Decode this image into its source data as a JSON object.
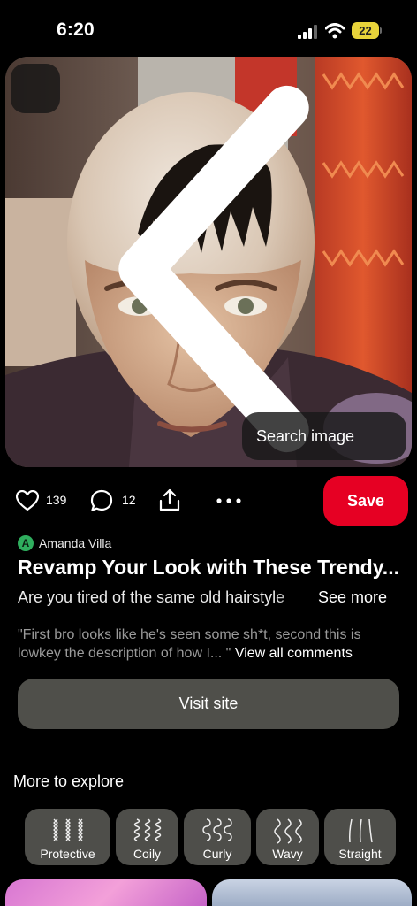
{
  "status_bar": {
    "time": "6:20",
    "battery": "22"
  },
  "hero": {
    "search_image_label": "Search image"
  },
  "actions": {
    "likes": "139",
    "comments": "12",
    "save_label": "Save"
  },
  "pin": {
    "author_initial": "A",
    "author_name": "Amanda Villa",
    "title": "Revamp Your Look with These Trendy...",
    "description": "Are you tired of the same old hairstyle",
    "see_more": "See more",
    "comment_preview": "\"First bro looks like he's seen some sh*t, second this is lowkey the description of how I... \"",
    "view_all_comments": "View all comments",
    "visit_site": "Visit site"
  },
  "explore": {
    "heading": "More to explore",
    "chips": [
      {
        "label": "Protective",
        "icon": "braids-icon"
      },
      {
        "label": "Coily",
        "icon": "coils-icon"
      },
      {
        "label": "Curly",
        "icon": "curls-icon"
      },
      {
        "label": "Wavy",
        "icon": "waves-icon"
      },
      {
        "label": "Straight",
        "icon": "straight-lines-icon"
      }
    ]
  },
  "colors": {
    "save": "#e60023",
    "chip": "#4e4e4a",
    "visit": "#4f4f4a",
    "author_avatar": "#2fae5e",
    "battery": "#e8d33a"
  }
}
